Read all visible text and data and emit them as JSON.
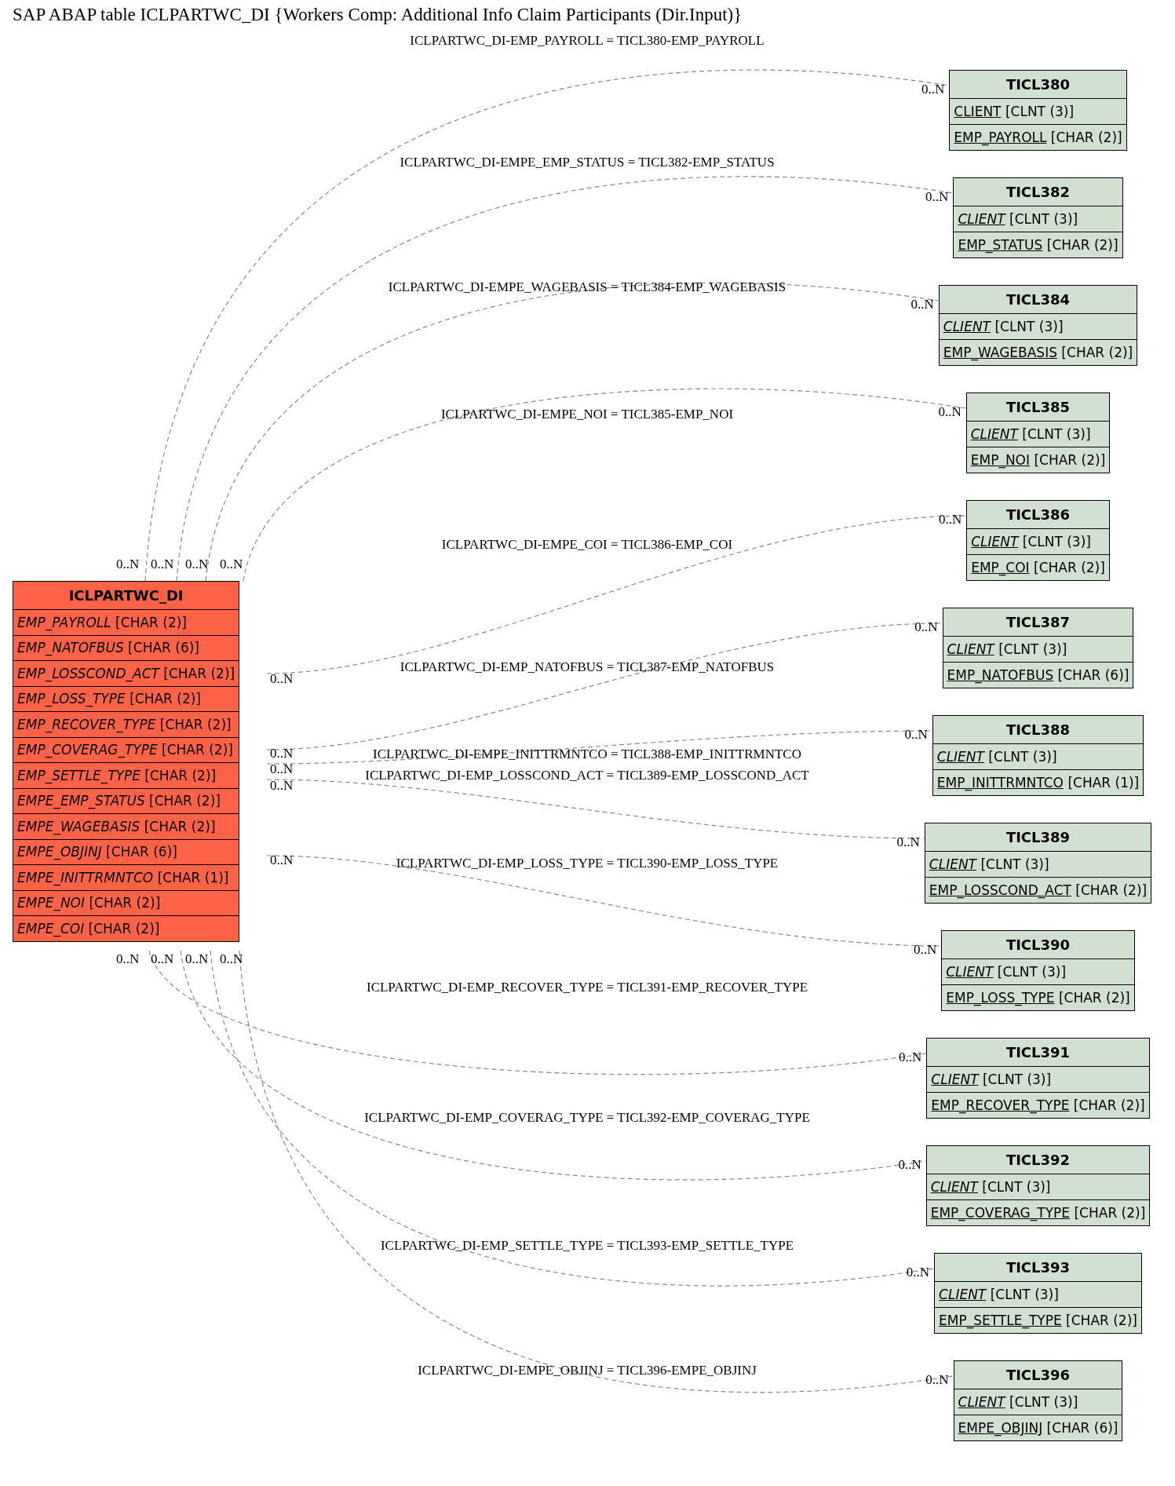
{
  "title": "SAP ABAP table ICLPARTWC_DI {Workers Comp: Additional Info Claim Participants (Dir.Input)}",
  "main_table": {
    "name": "ICLPARTWC_DI",
    "fields": [
      {
        "name": "EMP_PAYROLL",
        "type": "[CHAR (2)]",
        "key": false,
        "foreign": true
      },
      {
        "name": "EMP_NATOFBUS",
        "type": "[CHAR (6)]",
        "key": false,
        "foreign": true
      },
      {
        "name": "EMP_LOSSCOND_ACT",
        "type": "[CHAR (2)]",
        "key": false,
        "foreign": true
      },
      {
        "name": "EMP_LOSS_TYPE",
        "type": "[CHAR (2)]",
        "key": false,
        "foreign": true
      },
      {
        "name": "EMP_RECOVER_TYPE",
        "type": "[CHAR (2)]",
        "key": false,
        "foreign": true
      },
      {
        "name": "EMP_COVERAG_TYPE",
        "type": "[CHAR (2)]",
        "key": false,
        "foreign": true
      },
      {
        "name": "EMP_SETTLE_TYPE",
        "type": "[CHAR (2)]",
        "key": false,
        "foreign": true
      },
      {
        "name": "EMPE_EMP_STATUS",
        "type": "[CHAR (2)]",
        "key": false,
        "foreign": true
      },
      {
        "name": "EMPE_WAGEBASIS",
        "type": "[CHAR (2)]",
        "key": false,
        "foreign": true
      },
      {
        "name": "EMPE_OBJINJ",
        "type": "[CHAR (6)]",
        "key": false,
        "foreign": true
      },
      {
        "name": "EMPE_INITTRMNTCO",
        "type": "[CHAR (1)]",
        "key": false,
        "foreign": true
      },
      {
        "name": "EMPE_NOI",
        "type": "[CHAR (2)]",
        "key": false,
        "foreign": true
      },
      {
        "name": "EMPE_COI",
        "type": "[CHAR (2)]",
        "key": false,
        "foreign": true
      }
    ]
  },
  "related_tables": [
    {
      "name": "TICL380",
      "fields": [
        {
          "name": "CLIENT",
          "type": "[CLNT (3)]",
          "key": true,
          "foreign": false
        },
        {
          "name": "EMP_PAYROLL",
          "type": "[CHAR (2)]",
          "key": true,
          "foreign": false
        }
      ]
    },
    {
      "name": "TICL382",
      "fields": [
        {
          "name": "CLIENT",
          "type": "[CLNT (3)]",
          "key": true,
          "foreign": true
        },
        {
          "name": "EMP_STATUS",
          "type": "[CHAR (2)]",
          "key": true,
          "foreign": false
        }
      ]
    },
    {
      "name": "TICL384",
      "fields": [
        {
          "name": "CLIENT",
          "type": "[CLNT (3)]",
          "key": true,
          "foreign": true
        },
        {
          "name": "EMP_WAGEBASIS",
          "type": "[CHAR (2)]",
          "key": true,
          "foreign": false
        }
      ]
    },
    {
      "name": "TICL385",
      "fields": [
        {
          "name": "CLIENT",
          "type": "[CLNT (3)]",
          "key": true,
          "foreign": true
        },
        {
          "name": "EMP_NOI",
          "type": "[CHAR (2)]",
          "key": true,
          "foreign": false
        }
      ]
    },
    {
      "name": "TICL386",
      "fields": [
        {
          "name": "CLIENT",
          "type": "[CLNT (3)]",
          "key": true,
          "foreign": true
        },
        {
          "name": "EMP_COI",
          "type": "[CHAR (2)]",
          "key": true,
          "foreign": false
        }
      ]
    },
    {
      "name": "TICL387",
      "fields": [
        {
          "name": "CLIENT",
          "type": "[CLNT (3)]",
          "key": true,
          "foreign": true
        },
        {
          "name": "EMP_NATOFBUS",
          "type": "[CHAR (6)]",
          "key": true,
          "foreign": false
        }
      ]
    },
    {
      "name": "TICL388",
      "fields": [
        {
          "name": "CLIENT",
          "type": "[CLNT (3)]",
          "key": true,
          "foreign": true
        },
        {
          "name": "EMP_INITTRMNTCO",
          "type": "[CHAR (1)]",
          "key": true,
          "foreign": false
        }
      ]
    },
    {
      "name": "TICL389",
      "fields": [
        {
          "name": "CLIENT",
          "type": "[CLNT (3)]",
          "key": true,
          "foreign": true
        },
        {
          "name": "EMP_LOSSCOND_ACT",
          "type": "[CHAR (2)]",
          "key": true,
          "foreign": false
        }
      ]
    },
    {
      "name": "TICL390",
      "fields": [
        {
          "name": "CLIENT",
          "type": "[CLNT (3)]",
          "key": true,
          "foreign": true
        },
        {
          "name": "EMP_LOSS_TYPE",
          "type": "[CHAR (2)]",
          "key": true,
          "foreign": false
        }
      ]
    },
    {
      "name": "TICL391",
      "fields": [
        {
          "name": "CLIENT",
          "type": "[CLNT (3)]",
          "key": true,
          "foreign": true
        },
        {
          "name": "EMP_RECOVER_TYPE",
          "type": "[CHAR (2)]",
          "key": true,
          "foreign": false
        }
      ]
    },
    {
      "name": "TICL392",
      "fields": [
        {
          "name": "CLIENT",
          "type": "[CLNT (3)]",
          "key": true,
          "foreign": true
        },
        {
          "name": "EMP_COVERAG_TYPE",
          "type": "[CHAR (2)]",
          "key": true,
          "foreign": false
        }
      ]
    },
    {
      "name": "TICL393",
      "fields": [
        {
          "name": "CLIENT",
          "type": "[CLNT (3)]",
          "key": true,
          "foreign": true
        },
        {
          "name": "EMP_SETTLE_TYPE",
          "type": "[CHAR (2)]",
          "key": true,
          "foreign": false
        }
      ]
    },
    {
      "name": "TICL396",
      "fields": [
        {
          "name": "CLIENT",
          "type": "[CLNT (3)]",
          "key": true,
          "foreign": true
        },
        {
          "name": "EMPE_OBJINJ",
          "type": "[CHAR (6)]",
          "key": true,
          "foreign": false
        }
      ]
    }
  ],
  "relations": [
    {
      "label": "ICLPARTWC_DI-EMP_PAYROLL = TICL380-EMP_PAYROLL",
      "source_cardinality": "0..N",
      "target_cardinality": "0..N"
    },
    {
      "label": "ICLPARTWC_DI-EMPE_EMP_STATUS = TICL382-EMP_STATUS",
      "source_cardinality": "0..N",
      "target_cardinality": "0..N"
    },
    {
      "label": "ICLPARTWC_DI-EMPE_WAGEBASIS = TICL384-EMP_WAGEBASIS",
      "source_cardinality": "0..N",
      "target_cardinality": "0..N"
    },
    {
      "label": "ICLPARTWC_DI-EMPE_NOI = TICL385-EMP_NOI",
      "source_cardinality": "0..N",
      "target_cardinality": "0..N"
    },
    {
      "label": "ICLPARTWC_DI-EMPE_COI = TICL386-EMP_COI",
      "source_cardinality": "0..N",
      "target_cardinality": "0..N"
    },
    {
      "label": "ICLPARTWC_DI-EMP_NATOFBUS = TICL387-EMP_NATOFBUS",
      "source_cardinality": "0..N",
      "target_cardinality": "0..N"
    },
    {
      "label": "ICLPARTWC_DI-EMPE_INITTRMNTCO = TICL388-EMP_INITTRMNTCO",
      "source_cardinality": "0..N",
      "target_cardinality": "0..N"
    },
    {
      "label": "ICLPARTWC_DI-EMP_LOSSCOND_ACT = TICL389-EMP_LOSSCOND_ACT",
      "source_cardinality": "0..N",
      "target_cardinality": "0..N"
    },
    {
      "label": "ICLPARTWC_DI-EMP_LOSS_TYPE = TICL390-EMP_LOSS_TYPE",
      "source_cardinality": "0..N",
      "target_cardinality": "0..N"
    },
    {
      "label": "ICLPARTWC_DI-EMP_RECOVER_TYPE = TICL391-EMP_RECOVER_TYPE",
      "source_cardinality": "0..N",
      "target_cardinality": "0..N"
    },
    {
      "label": "ICLPARTWC_DI-EMP_COVERAG_TYPE = TICL392-EMP_COVERAG_TYPE",
      "source_cardinality": "0..N",
      "target_cardinality": "0..N"
    },
    {
      "label": "ICLPARTWC_DI-EMP_SETTLE_TYPE = TICL393-EMP_SETTLE_TYPE",
      "source_cardinality": "0..N",
      "target_cardinality": "0..N"
    },
    {
      "label": "ICLPARTWC_DI-EMPE_OBJINJ = TICL396-EMPE_OBJINJ",
      "source_cardinality": "0..N",
      "target_cardinality": "0..N"
    }
  ]
}
